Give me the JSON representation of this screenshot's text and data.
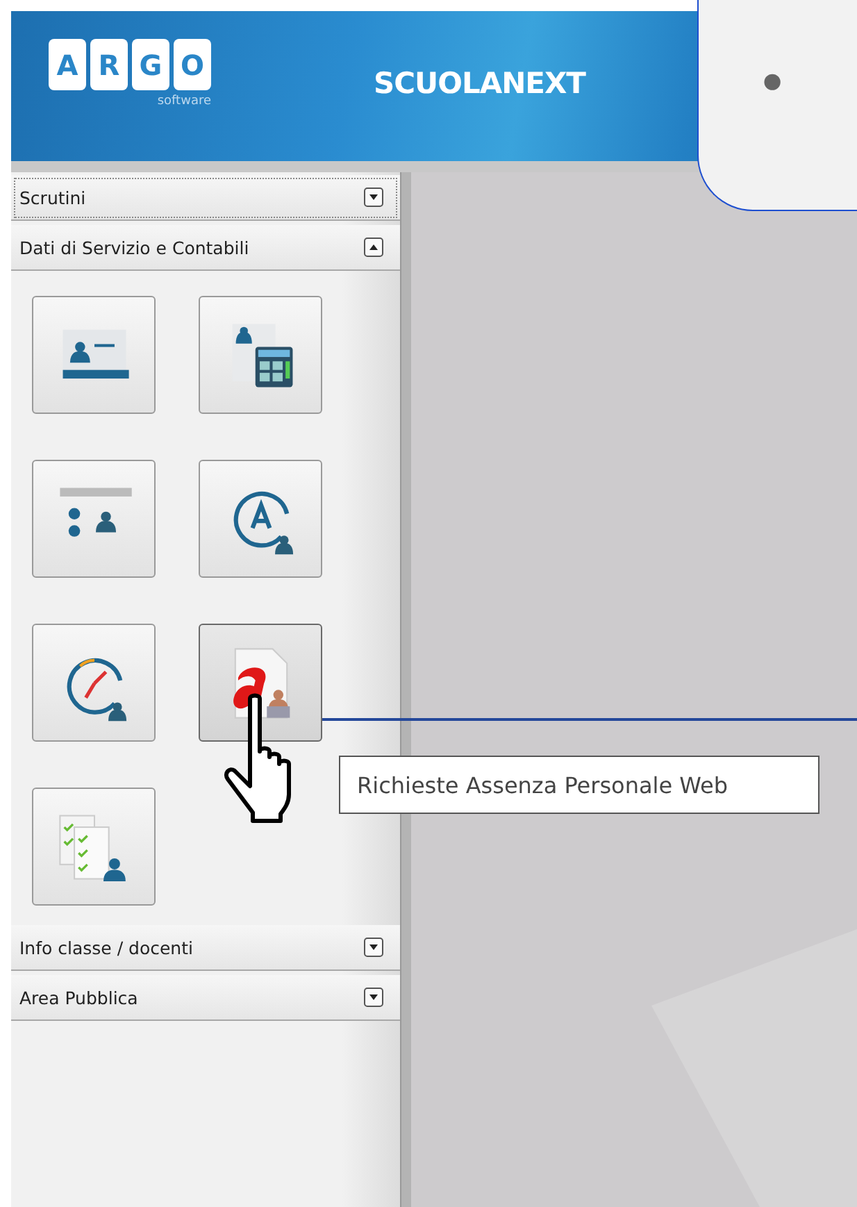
{
  "header": {
    "logo_letters": [
      "A",
      "R",
      "G",
      "O"
    ],
    "logo_subtitle": "software",
    "product": "SCUOLANEXT"
  },
  "callout": {
    "marker": "•"
  },
  "sidebar": {
    "sections": [
      {
        "title": "Scrutini",
        "expanded": false,
        "focused": true
      },
      {
        "title": "Dati di Servizio e Contabili",
        "expanded": true,
        "focused": false,
        "tiles": [
          {
            "kind": "id-card",
            "hovered": false
          },
          {
            "kind": "calculator",
            "hovered": false
          },
          {
            "kind": "org-chart",
            "hovered": false
          },
          {
            "kind": "letter-user",
            "hovered": false
          },
          {
            "kind": "clock-user",
            "hovered": false
          },
          {
            "kind": "document-letter",
            "hovered": true
          },
          {
            "kind": "checklist",
            "hovered": false
          }
        ]
      },
      {
        "title": "Info classe / docenti",
        "expanded": false,
        "focused": false
      },
      {
        "title": "Area Pubblica",
        "expanded": false,
        "focused": false
      }
    ]
  },
  "tooltip": {
    "text": "Richieste Assenza Personale Web"
  }
}
